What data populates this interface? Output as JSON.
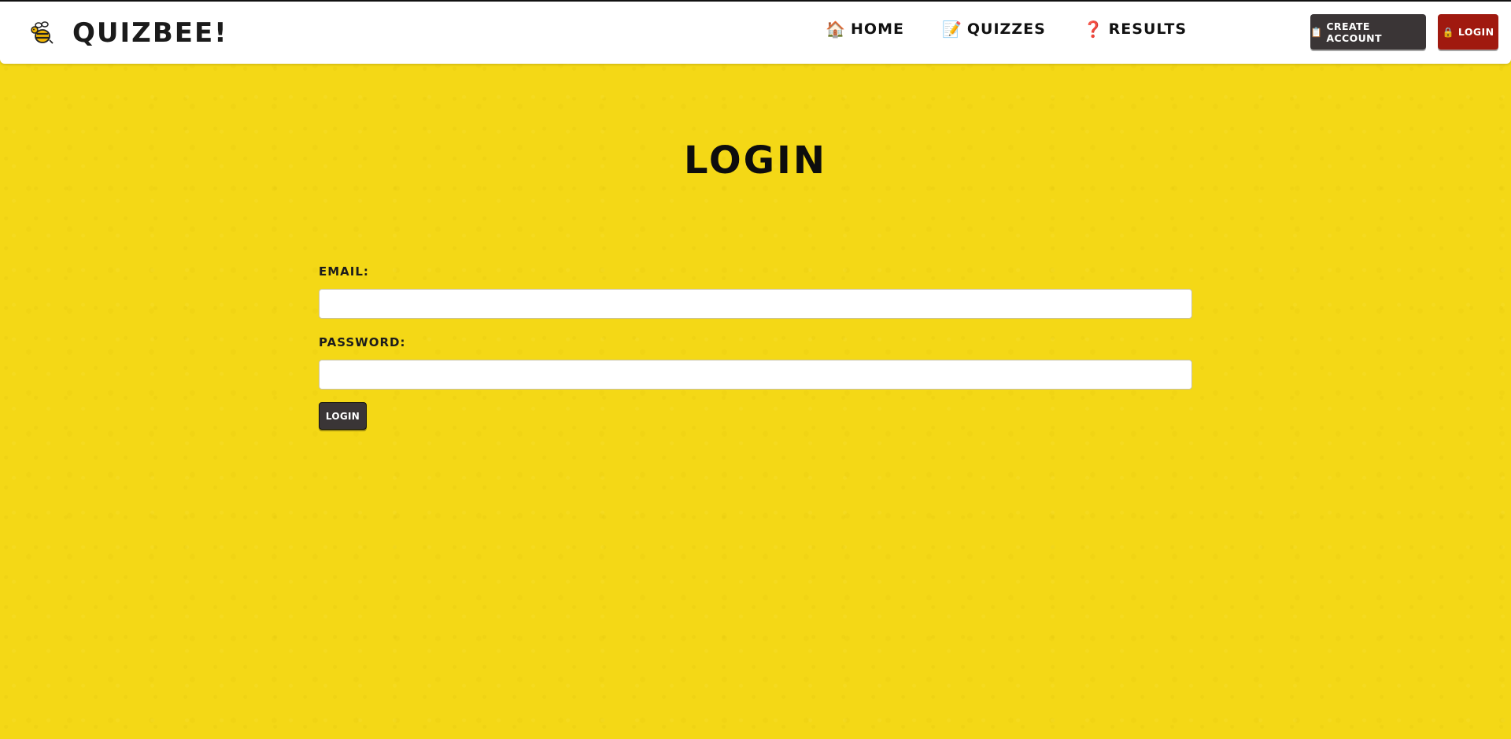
{
  "header": {
    "brand": {
      "icon": "bee-icon",
      "title": "QUIZBEE!"
    },
    "nav": [
      {
        "icon": "🏠",
        "icon_name": "house-icon",
        "label": "HOME"
      },
      {
        "icon": "📝",
        "icon_name": "memo-icon",
        "label": "QUIZZES"
      },
      {
        "icon": "❓",
        "icon_name": "question-mark-icon",
        "label": "RESULTS"
      }
    ],
    "create_account": {
      "icon": "📋",
      "icon_name": "clipboard-icon",
      "label": "CREATE ACCOUNT"
    },
    "login": {
      "icon": "🔒",
      "icon_name": "lock-icon",
      "label": "LOGIN"
    }
  },
  "main": {
    "title": "LOGIN",
    "form": {
      "email_label": "EMAIL:",
      "email_value": "",
      "password_label": "PASSWORD:",
      "password_value": "",
      "submit_label": "LOGIN"
    }
  },
  "colors": {
    "background": "#f4d816",
    "header_bg": "#ffffff",
    "dark_button": "#3a3536",
    "login_button": "#a0190f"
  }
}
